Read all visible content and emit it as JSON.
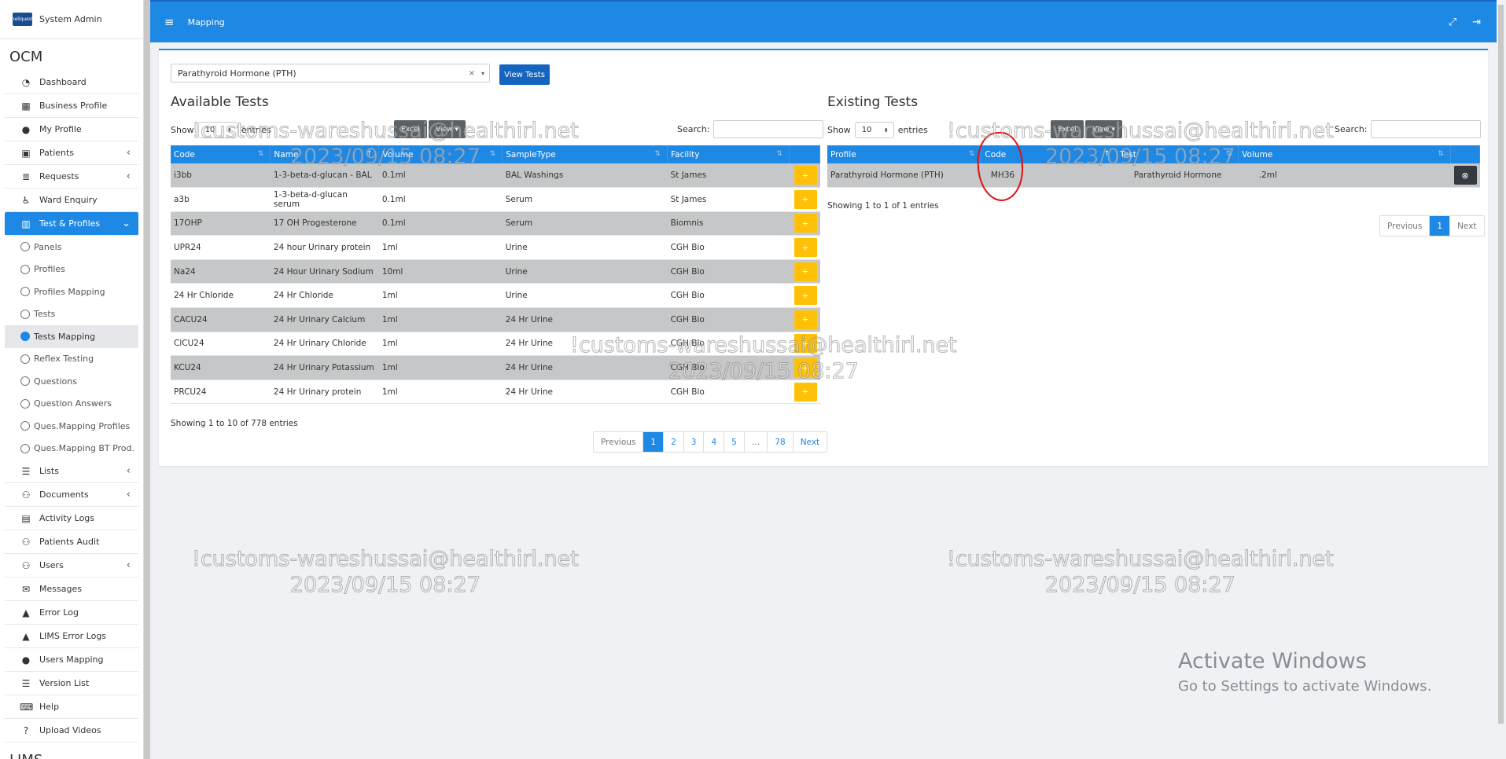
{
  "sidebar": {
    "user": "System Admin",
    "logo_text": "heliquest",
    "section_ocm": "OCM",
    "section_lims": "LIMS",
    "items_top": [
      {
        "label": "Dashboard",
        "icon": "dashboard-icon"
      },
      {
        "label": "Business Profile",
        "icon": "building-icon"
      },
      {
        "label": "My Profile",
        "icon": "user-icon"
      },
      {
        "label": "Patients",
        "icon": "patients-icon"
      },
      {
        "label": "Requests",
        "icon": "database-icon"
      },
      {
        "label": "Ward Enquiry",
        "icon": "wheelchair-icon"
      },
      {
        "label": "Test & Profiles",
        "icon": "flask-icon"
      }
    ],
    "sub_items": [
      {
        "label": "Panels"
      },
      {
        "label": "Profiles"
      },
      {
        "label": "Profiles Mapping"
      },
      {
        "label": "Tests"
      },
      {
        "label": "Tests Mapping"
      },
      {
        "label": "Reflex Testing"
      },
      {
        "label": "Questions"
      },
      {
        "label": "Question Answers"
      },
      {
        "label": "Ques.Mapping Profiles"
      },
      {
        "label": "Ques.Mapping BT Prod."
      }
    ],
    "items_bottom": [
      {
        "label": "Lists",
        "icon": "list-icon"
      },
      {
        "label": "Documents",
        "icon": "users-icon"
      },
      {
        "label": "Activity Logs",
        "icon": "archive-icon"
      },
      {
        "label": "Patients Audit",
        "icon": "users-icon"
      },
      {
        "label": "Users",
        "icon": "users-icon"
      },
      {
        "label": "Messages",
        "icon": "envelope-icon"
      },
      {
        "label": "Error Log",
        "icon": "warning-icon"
      },
      {
        "label": "LIMS Error Logs",
        "icon": "warning-icon"
      },
      {
        "label": "Users Mapping",
        "icon": "user-icon"
      },
      {
        "label": "Version List",
        "icon": "list-icon"
      },
      {
        "label": "Help",
        "icon": "keyboard-icon"
      },
      {
        "label": "Upload Videos",
        "icon": "question-icon"
      }
    ]
  },
  "topbar": {
    "title": "Mapping"
  },
  "selector": {
    "value": "Parathyroid Hormone (PTH)",
    "button": "View Tests"
  },
  "available": {
    "title": "Available Tests",
    "show_label": "Show",
    "entries_label": "entries",
    "page_size": "10",
    "excel": "Excel",
    "view": "View",
    "search_label": "Search:",
    "columns": [
      "Code",
      "Name",
      "Volume",
      "SampleType",
      "Facility"
    ],
    "rows": [
      [
        "i3bb",
        "1-3-beta-d-glucan - BAL",
        "0.1ml",
        "BAL Washings",
        "St James"
      ],
      [
        "a3b",
        "1-3-beta-d-glucan serum",
        "0.1ml",
        "Serum",
        "St James"
      ],
      [
        "17OHP",
        "17 OH Progesterone",
        "0.1ml",
        "Serum",
        "Biomnis"
      ],
      [
        "UPR24",
        "24 hour Urinary protein",
        "1ml",
        "Urine",
        "CGH Bio"
      ],
      [
        "Na24",
        "24 Hour Urinary Sodium",
        "10ml",
        "Urine",
        "CGH Bio"
      ],
      [
        "24 Hr Chloride",
        "24 Hr Chloride",
        "1ml",
        "Urine",
        "CGH Bio"
      ],
      [
        "CACU24",
        "24 Hr Urinary Calcium",
        "1ml",
        "24 Hr Urine",
        "CGH Bio"
      ],
      [
        "ClCU24",
        "24 Hr Urinary Chloride",
        "1ml",
        "24 Hr Urine",
        "CGH Bio"
      ],
      [
        "KCU24",
        "24 Hr Urinary Potassium",
        "1ml",
        "24 Hr Urine",
        "CGH Bio"
      ],
      [
        "PRCU24",
        "24 Hr Urinary protein",
        "1ml",
        "24 Hr Urine",
        "CGH Bio"
      ]
    ],
    "info": "Showing 1 to 10 of 778 entries",
    "pager": [
      "Previous",
      "1",
      "2",
      "3",
      "4",
      "5",
      "…",
      "78",
      "Next"
    ]
  },
  "existing": {
    "title": "Existing Tests",
    "show_label": "Show",
    "entries_label": "entries",
    "page_size": "10",
    "excel": "Excel",
    "view": "View",
    "search_label": "Search:",
    "columns": [
      "Profile",
      "Code",
      "Test",
      "Volume"
    ],
    "rows": [
      [
        "Parathyroid Hormone (PTH)",
        "MH36",
        "Parathyroid Hormone",
        ".2ml"
      ]
    ],
    "info": "Showing 1 to 1 of 1 entries",
    "pager": [
      "Previous",
      "1",
      "Next"
    ]
  },
  "watermark": {
    "line1": "!customs-wareshussai@healthirl.net",
    "line2": "2023/09/15 08:27"
  },
  "os_notice": {
    "line1": "Activate Windows",
    "line2": "Go to Settings to activate Windows."
  },
  "colors": {
    "primary": "#1e88e5",
    "add": "#ffc107",
    "dark": "#343a40",
    "annotation": "#e01010"
  }
}
